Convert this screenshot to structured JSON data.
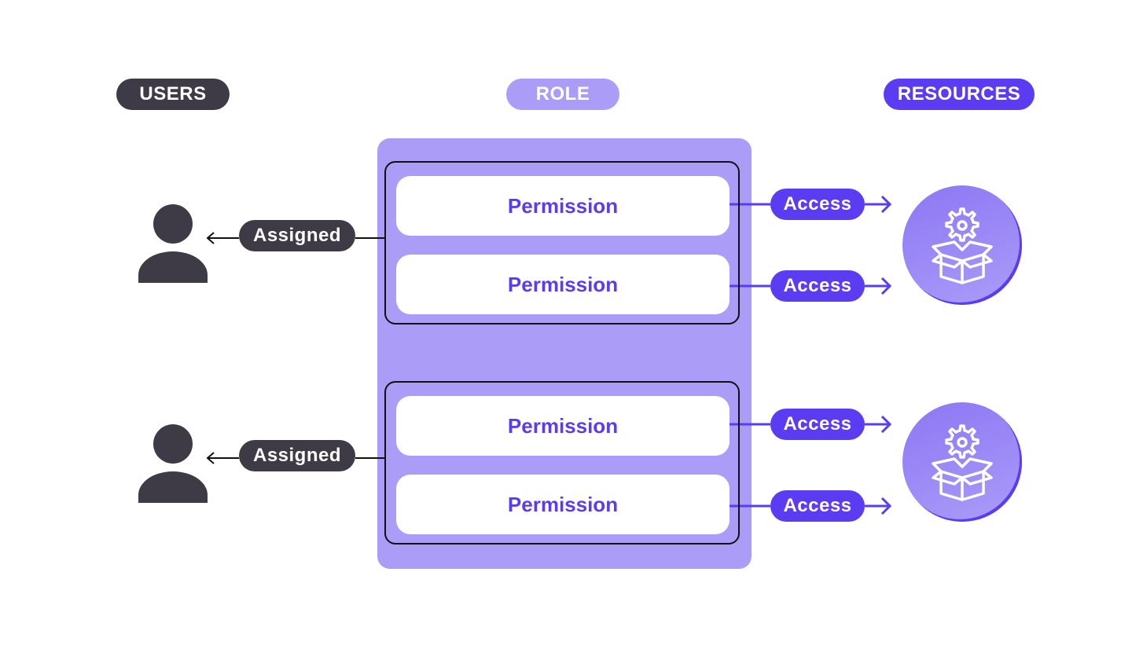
{
  "headers": {
    "users": "USERS",
    "role": "ROLE",
    "resources": "RESOURCES"
  },
  "groups": [
    {
      "assigned_label": "Assigned",
      "permissions": [
        {
          "label": "Permission",
          "access_label": "Access"
        },
        {
          "label": "Permission",
          "access_label": "Access"
        }
      ],
      "resource_icon": "gear-box-icon"
    },
    {
      "assigned_label": "Assigned",
      "permissions": [
        {
          "label": "Permission",
          "access_label": "Access"
        },
        {
          "label": "Permission",
          "access_label": "Access"
        }
      ],
      "resource_icon": "gear-box-icon"
    }
  ],
  "icons": {
    "user": "user-icon",
    "resource": "gear-box-icon",
    "arrow": "arrow-icon"
  },
  "colors": {
    "dark": "#3e3b46",
    "role_light": "#ab9cf8",
    "accent": "#5b3cf2",
    "white": "#ffffff"
  }
}
